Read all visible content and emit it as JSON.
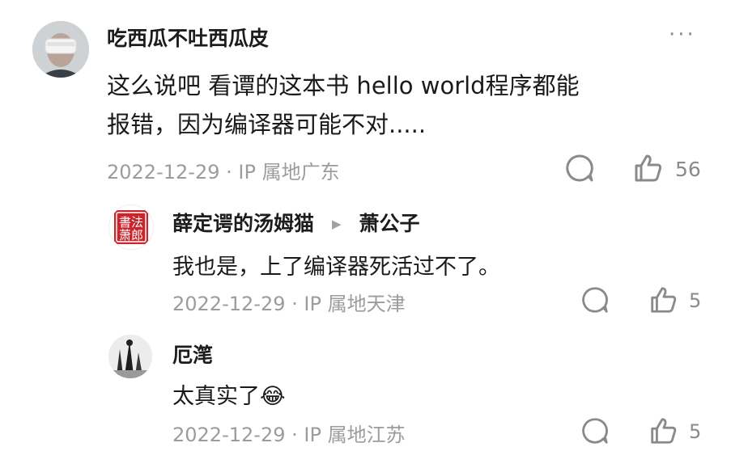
{
  "comments": [
    {
      "username": "吃西瓜不吐西瓜皮",
      "avatar_icon": "vr-headset-person-avatar",
      "text_line1": "这么说吧 看谭的这本书 hello world程序都能",
      "text_line2": "报错，因为编译器可能不对.....",
      "date": "2022-12-29",
      "location": "IP 属地广东",
      "like_count": "56"
    }
  ],
  "replies": [
    {
      "username": "薛定谔的汤姆猫",
      "reply_to": "萧公子",
      "avatar_text": "法萧書郎",
      "text": "我也是，上了编译器死活过不了。",
      "date": "2022-12-29",
      "location": "IP 属地天津",
      "like_count": "5"
    },
    {
      "username": "厄滗",
      "text": "太真实了",
      "emoji": "😂",
      "date": "2022-12-29",
      "location": "IP 属地江苏",
      "like_count": "5"
    }
  ],
  "more_menu": "···"
}
